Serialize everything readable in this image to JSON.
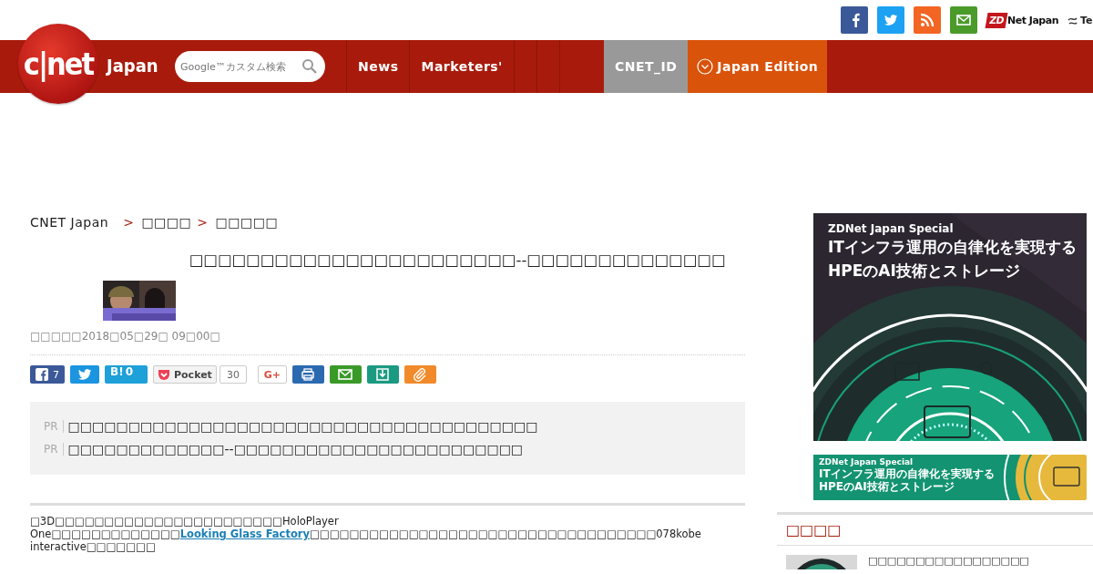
{
  "top_bar": {
    "social": [
      {
        "kind": "facebook"
      },
      {
        "kind": "twitter"
      },
      {
        "kind": "rss"
      },
      {
        "kind": "mail"
      }
    ],
    "partners": [
      {
        "kind": "zdnet",
        "mark": "ZD",
        "label": "Net Japan"
      },
      {
        "kind": "tech",
        "label": "Te"
      }
    ]
  },
  "header": {
    "logo": "c|net",
    "edition": "Japan",
    "search": {
      "placeholder": "Google™カスタム検索"
    },
    "nav": [
      {
        "kind": "link",
        "label": "News"
      },
      {
        "kind": "link",
        "label": "Marketers'"
      },
      {
        "kind": "blank"
      },
      {
        "kind": "blank"
      },
      {
        "kind": "blank"
      },
      {
        "kind": "id",
        "label": "CNET_ID"
      },
      {
        "kind": "edition",
        "label": "Japan Edition"
      }
    ]
  },
  "breadcrumb": [
    {
      "label": "CNET Japan"
    },
    {
      "separator": ">",
      "label": "□□□□"
    },
    {
      "separator": ">",
      "label": "□□□□□"
    }
  ],
  "article": {
    "title": "□□□□□□□□□□□□□□□□□□□□□□□--□□□□□□□□□□□□□□",
    "date": "□□□□□2018□05□29□ 09□00□",
    "share": [
      {
        "kind": "facebook",
        "count": "7"
      },
      {
        "kind": "twitter"
      },
      {
        "kind": "hatena",
        "label": "B!",
        "count": "0"
      },
      {
        "kind": "pocket",
        "label": "Pocket",
        "count": "30"
      },
      {
        "kind": "gplus",
        "label": "G+"
      },
      {
        "kind": "print"
      },
      {
        "kind": "mail"
      },
      {
        "kind": "save"
      },
      {
        "kind": "clip"
      }
    ],
    "pr": [
      {
        "tag": "PR",
        "text": "□□□□□□□□□□□□□□□□□□□□□□□□□□□□□□□□□□□□□□□"
      },
      {
        "tag": "PR",
        "text": "□□□□□□□□□□□□□--□□□□□□□□□□□□□□□□□□□□□□□□"
      }
    ],
    "body": {
      "before": "□3D□□□□□□□□□□□□□□□□□□□□□□□HoloPlayer One□□□□□□□□□□□□□",
      "link": "Looking Glass Factory",
      "after": "□□□□□□□□□□□□□□□□□□□□□□□□□□□□□□□□□□□078kobe interactive□□□□□□□"
    }
  },
  "sidebar": {
    "ads": [
      {
        "kind": "large",
        "brand": "ZDNet Japan Special",
        "lines": [
          "ITインフラ運用の自律化を実現する",
          "HPEのAI技術とストレージ"
        ]
      },
      {
        "kind": "small",
        "brand": "ZDNet Japan Special",
        "lines": [
          "ITインフラ運用の自律化を実現する",
          "HPEのAI技術とストレージ"
        ]
      }
    ],
    "section": {
      "title": "□□□□",
      "items": [
        {
          "text": "□□□□□□□□□□□□□□□□□"
        }
      ]
    }
  }
}
